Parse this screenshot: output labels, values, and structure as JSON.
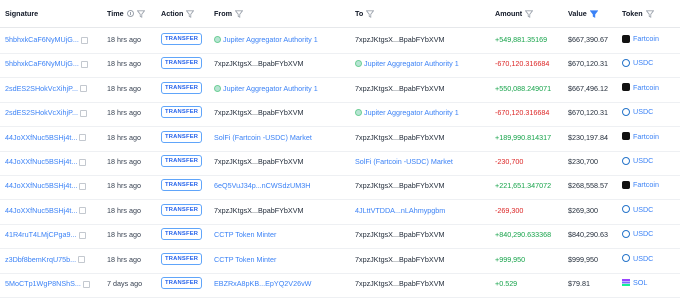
{
  "headers": {
    "signature": "Signature",
    "time": "Time",
    "action": "Action",
    "from": "From",
    "to": "To",
    "amount": "Amount",
    "value": "Value",
    "token": "Token"
  },
  "colors": {
    "link": "#3b82f6",
    "positive": "#16a34a",
    "negative": "#dc2626",
    "badge": "#2563eb"
  },
  "rows": [
    {
      "sig": "5hbhxkCaF6NyMUjG...",
      "time": "18 hrs ago",
      "action": "TRANSFER",
      "from": "Jupiter Aggregator Authority 1",
      "to": "7xpzJKtgsX...BpabFYbXVM",
      "amount": "+549,881.35169",
      "value": "$667,390.67",
      "token": "Fartcoin"
    },
    {
      "sig": "5hbhxkCaF6NyMUjG...",
      "time": "18 hrs ago",
      "action": "TRANSFER",
      "from": "7xpzJKtgsX...BpabFYbXVM",
      "to": "Jupiter Aggregator Authority 1",
      "amount": "-670,120.316684",
      "value": "$670,120.31",
      "token": "USDC"
    },
    {
      "sig": "2sdES2SHokVcXihjP...",
      "time": "18 hrs ago",
      "action": "TRANSFER",
      "from": "Jupiter Aggregator Authority 1",
      "to": "7xpzJKtgsX...BpabFYbXVM",
      "amount": "+550,088.249071",
      "value": "$667,496.12",
      "token": "Fartcoin"
    },
    {
      "sig": "2sdES2SHokVcXihjP...",
      "time": "18 hrs ago",
      "action": "TRANSFER",
      "from": "7xpzJKtgsX...BpabFYbXVM",
      "to": "Jupiter Aggregator Authority 1",
      "amount": "-670,120.316684",
      "value": "$670,120.31",
      "token": "USDC"
    },
    {
      "sig": "44JoXXfNuc5BSHj4t...",
      "time": "18 hrs ago",
      "action": "TRANSFER",
      "from": "SolFi (Fartcoin -USDC) Market",
      "to": "7xpzJKtgsX...BpabFYbXVM",
      "amount": "+189,990.814317",
      "value": "$230,197.84",
      "token": "Fartcoin"
    },
    {
      "sig": "44JoXXfNuc5BSHj4t...",
      "time": "18 hrs ago",
      "action": "TRANSFER",
      "from": "7xpzJKtgsX...BpabFYbXVM",
      "to": "SolFi (Fartcoin -USDC) Market",
      "amount": "-230,700",
      "value": "$230,700",
      "token": "USDC"
    },
    {
      "sig": "44JoXXfNuc5BSHj4t...",
      "time": "18 hrs ago",
      "action": "TRANSFER",
      "from": "6eQ5VuJ34p...nCWSdzUM3H",
      "to": "7xpzJKtgsX...BpabFYbXVM",
      "amount": "+221,651.347072",
      "value": "$268,558.57",
      "token": "Fartcoin"
    },
    {
      "sig": "44JoXXfNuc5BSHj4t...",
      "time": "18 hrs ago",
      "action": "TRANSFER",
      "from": "7xpzJKtgsX...BpabFYbXVM",
      "to": "4JLttVTDDA...nLAhmypgbm",
      "amount": "-269,300",
      "value": "$269,300",
      "token": "USDC"
    },
    {
      "sig": "41R4ruT4LMjCPga9...",
      "time": "18 hrs ago",
      "action": "TRANSFER",
      "from": "CCTP Token Minter",
      "to": "7xpzJKtgsX...BpabFYbXVM",
      "amount": "+840,290.633368",
      "value": "$840,290.63",
      "token": "USDC"
    },
    {
      "sig": "z3Dbf8bemKrqU75b...",
      "time": "18 hrs ago",
      "action": "TRANSFER",
      "from": "CCTP Token Minter",
      "to": "7xpzJKtgsX...BpabFYbXVM",
      "amount": "+999,950",
      "value": "$999,950",
      "token": "USDC"
    },
    {
      "sig": "5MoCTp1WgP8NShS...",
      "time": "7 days ago",
      "action": "TRANSFER",
      "from": "EBZRxA8pKB...EpYQ2V26vW",
      "to": "7xpzJKtgsX...BpabFYbXVM",
      "amount": "+0.529",
      "value": "$79.81",
      "token": "SOL"
    }
  ]
}
